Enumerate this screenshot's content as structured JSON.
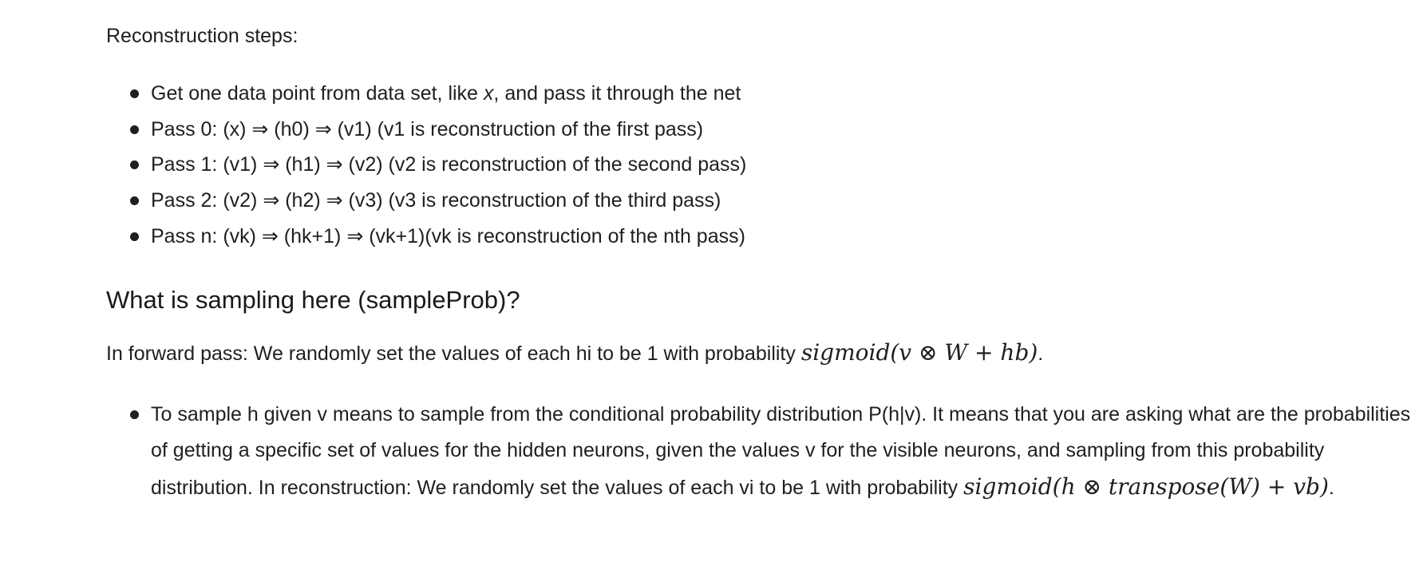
{
  "intro": "Reconstruction steps:",
  "steps": [
    {
      "pre": "Get one data point from data set, like ",
      "var": "x",
      "post": ", and pass it through the net"
    },
    {
      "text": "Pass 0: (x) ⇒ (h0) ⇒ (v1) (v1 is reconstruction of the first pass)"
    },
    {
      "text": "Pass 1: (v1) ⇒ (h1) ⇒ (v2) (v2 is reconstruction of the second pass)"
    },
    {
      "text": "Pass 2: (v2) ⇒ (h2) ⇒ (v3) (v3 is reconstruction of the third pass)"
    },
    {
      "text": "Pass n: (vk) ⇒ (hk+1) ⇒ (vk+1)(vk is reconstruction of the nth pass)"
    }
  ],
  "heading": "What is sampling here (sampleProb)?",
  "forward": {
    "text": "In forward pass: We randomly set the values of each hi to be 1 with probability ",
    "formula": "sigmoid(v ⊗ W + hb)",
    "end": "."
  },
  "sample_item": {
    "text": "To sample h given v means to sample from the conditional probability distribution P(h|v). It means that you are asking what are the probabilities of getting a specific set of values for the hidden neurons, given the values v for the visible neurons, and sampling from this probability distribution. In reconstruction: We randomly set the values of each vi to be 1 with probability ",
    "formula": "sigmoid(h ⊗ transpose(W) + vb)",
    "end": "."
  }
}
